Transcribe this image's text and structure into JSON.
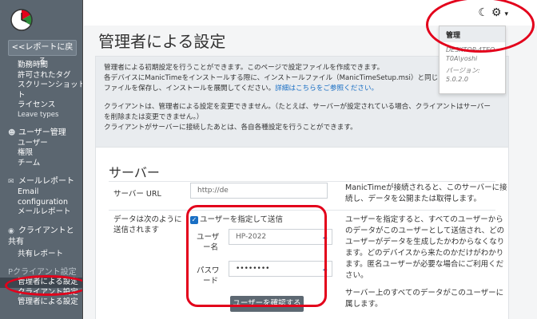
{
  "sidebar": {
    "back_label": "<<レポートに戻る",
    "items": [
      {
        "type": "sub",
        "label": "勤務時間"
      },
      {
        "type": "sub",
        "label": "許可されたタグ"
      },
      {
        "type": "sub",
        "label": "スクリーンショット"
      },
      {
        "type": "sub",
        "label": "ト"
      },
      {
        "type": "sub",
        "label": "ライセンス"
      },
      {
        "type": "sub-small",
        "label": "Leave types"
      }
    ],
    "user_mgmt": {
      "icon": "users-icon",
      "label": "ユーザー管理",
      "items": [
        "ユーザー",
        "権限",
        "チーム"
      ]
    },
    "mail_report": {
      "icon": "envelope-icon",
      "label": "メールレポート",
      "items": [
        "Email configuration",
        "メールレポート"
      ]
    },
    "client_share": {
      "icon": "eye-icon",
      "label": "クライアントと共有",
      "items": [
        "共有レポート"
      ]
    },
    "cut_header": {
      "label": "Pクライアント設定"
    },
    "admin_items": [
      "管理者による設定",
      "クライアント設定",
      "管理者による設定"
    ]
  },
  "header": {
    "moon_icon": "moon-icon",
    "gear_icon": "gear-icon",
    "caret": "▾"
  },
  "dropdown": {
    "admin": "管理",
    "pc_name": "DESKTOP-4TEOT0A\\yoshi",
    "version_label": "バージョン:",
    "version": "5.0.2.0"
  },
  "page": {
    "title": "管理者による設定",
    "intro": {
      "p1_line1": "管理者による初期設定を行うことができます。このページで設定ファイルを作成できます。",
      "p1_line2": "各デバイスにManicTimeをインストールする際に、インストールファイル（ManicTimeSetup.msi）と同じフ",
      "p1_line3": "ファイルを保存し、インストールを展開してください。",
      "p1_link": "詳細はこちらをご参照ください。",
      "p2_line1": "クライアントは、管理者による設定を変更できません。（たとえば、サーバーが設定されている場合、クライアントはサーバー",
      "p2_line2": "を削除または変更できません。）",
      "p2_line3": "クライアントがサーバーに接続したあとは、各自各種設定を行うことができます。"
    }
  },
  "server": {
    "title": "サーバー",
    "url_label": "サーバー URL",
    "url_placeholder": "http://de",
    "url_desc_line1": "ManicTimeが接続されると、このサーバーに接",
    "url_desc_line2": "続し、データを公開または取得します。",
    "send_label_line1": "データは次のように",
    "send_label_line2": "送信されます",
    "checkbox_label": "ユーザーを指定して送信",
    "user_name_label_line1": "ユーザ",
    "user_name_label_line2": "ー名",
    "user_name_value": "HP-2022",
    "password_label_line1": "パスワ",
    "password_label_line2": "ード",
    "password_value": "••••••••",
    "verify_button": "ユーザーを確認する",
    "send_desc": [
      "ユーザーを指定すると、すべてのユーザーから",
      "のデータがこのユーザーとして送信され、どの",
      "ユーザーがデータを生成したかわからなくなり",
      "ます。どのデバイスから来たのかだけがわかり",
      "ます。匿名ユーザーが必要な場合にご利用くだ",
      "さい。"
    ],
    "send_desc2_line1": "サーバー上のすべてのデータがこのユーザーに",
    "send_desc2_line2": "属します。"
  }
}
